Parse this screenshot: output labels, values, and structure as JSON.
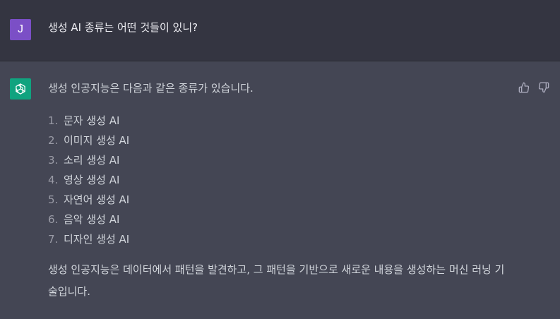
{
  "user_message": {
    "avatar_initial": "J",
    "text": "생성 AI 종류는 어떤 것들이 있니?"
  },
  "assistant_message": {
    "avatar_icon": "openai-logo-icon",
    "intro": "생성 인공지능은 다음과 같은 종류가 있습니다.",
    "items": [
      {
        "number": "1.",
        "label": "문자 생성 AI"
      },
      {
        "number": "2.",
        "label": "이미지 생성 AI"
      },
      {
        "number": "3.",
        "label": "소리 생성 AI"
      },
      {
        "number": "4.",
        "label": "영상 생성 AI"
      },
      {
        "number": "5.",
        "label": "자연어 생성 AI"
      },
      {
        "number": "6.",
        "label": "음악 생성 AI"
      },
      {
        "number": "7.",
        "label": "디자인 생성 AI"
      }
    ],
    "outro": "생성 인공지능은 데이터에서 패턴을 발견하고, 그 패턴을 기반으로 새로운 내용을 생성하는 머신 러닝 기술입니다."
  },
  "actions": {
    "thumbs_up_icon": "thumbs-up-icon",
    "thumbs_down_icon": "thumbs-down-icon"
  },
  "colors": {
    "user_bg": "#343541",
    "assistant_bg": "#444654",
    "user_avatar": "#7b4fc6",
    "bot_avatar": "#10a37f"
  }
}
